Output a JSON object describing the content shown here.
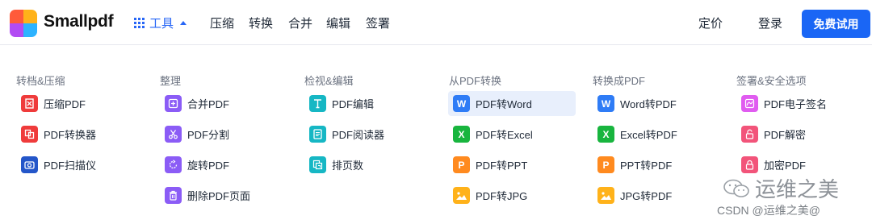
{
  "header": {
    "brand": "Smallpdf",
    "tools_label": "工具",
    "nav": [
      "压缩",
      "转换",
      "合并",
      "编辑",
      "签署"
    ],
    "pricing": "定价",
    "login": "登录",
    "trial": "免费试用",
    "accent_color": "#2766f6"
  },
  "menu": {
    "columns": [
      {
        "title": "转档&压缩",
        "items": [
          {
            "label": "压缩PDF",
            "icon": "compress-icon"
          },
          {
            "label": "PDF转换器",
            "icon": "convert-icon"
          },
          {
            "label": "PDF扫描仪",
            "icon": "camera-icon"
          }
        ]
      },
      {
        "title": "整理",
        "items": [
          {
            "label": "合并PDF",
            "icon": "merge-icon"
          },
          {
            "label": "PDF分割",
            "icon": "scissors-icon"
          },
          {
            "label": "旋转PDF",
            "icon": "rotate-icon"
          },
          {
            "label": "删除PDF页面",
            "icon": "trash-icon"
          }
        ]
      },
      {
        "title": "检视&编辑",
        "items": [
          {
            "label": "PDF编辑",
            "icon": "text-edit-icon"
          },
          {
            "label": "PDF阅读器",
            "icon": "reader-icon"
          },
          {
            "label": "排页数",
            "icon": "page-number-icon"
          }
        ]
      },
      {
        "title": "从PDF转换",
        "items": [
          {
            "label": "PDF转Word",
            "icon": "word-icon",
            "active": true
          },
          {
            "label": "PDF转Excel",
            "icon": "excel-icon"
          },
          {
            "label": "PDF转PPT",
            "icon": "ppt-icon"
          },
          {
            "label": "PDF转JPG",
            "icon": "jpg-icon"
          }
        ]
      },
      {
        "title": "转换成PDF",
        "items": [
          {
            "label": "Word转PDF",
            "icon": "word-icon"
          },
          {
            "label": "Excel转PDF",
            "icon": "excel-icon"
          },
          {
            "label": "PPT转PDF",
            "icon": "ppt-icon"
          },
          {
            "label": "JPG转PDF",
            "icon": "jpg-icon"
          }
        ]
      },
      {
        "title": "签署&安全选项",
        "items": [
          {
            "label": "PDF电子签名",
            "icon": "sign-icon"
          },
          {
            "label": "PDF解密",
            "icon": "unlock-icon"
          },
          {
            "label": "加密PDF",
            "icon": "lock-icon"
          }
        ]
      }
    ]
  },
  "watermark": {
    "channel": "运维之美",
    "credit": "CSDN @运维之美@"
  }
}
